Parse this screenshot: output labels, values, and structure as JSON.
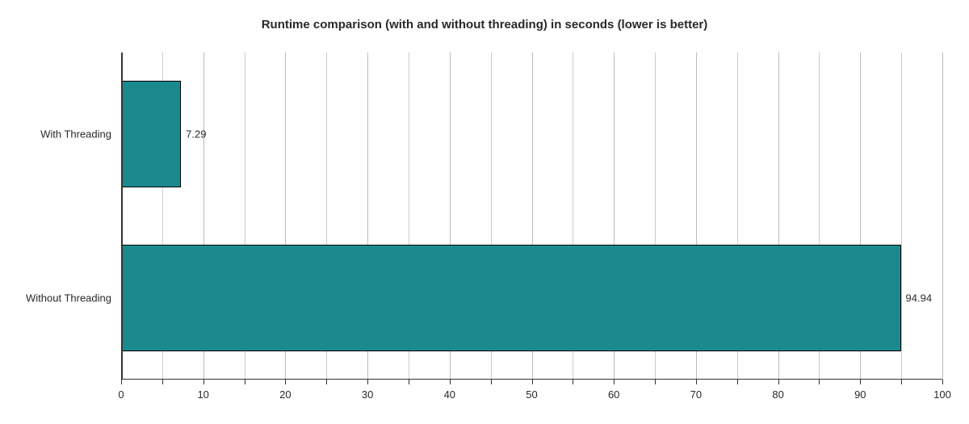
{
  "chart_data": {
    "type": "bar",
    "orientation": "horizontal",
    "title": "Runtime comparison (with and without threading) in seconds (lower is better)",
    "categories": [
      "With Threading",
      "Without Threading"
    ],
    "values": [
      7.29,
      94.94
    ],
    "xlim": [
      0,
      100
    ],
    "xticks": [
      0,
      5,
      10,
      15,
      20,
      25,
      30,
      35,
      40,
      45,
      50,
      55,
      60,
      65,
      70,
      75,
      80,
      85,
      90,
      95,
      100
    ],
    "xtick_labels": [
      "0",
      "",
      "10",
      "",
      "20",
      "",
      "30",
      "",
      "40",
      "",
      "50",
      "",
      "60",
      "",
      "70",
      "",
      "80",
      "",
      "90",
      "",
      "100"
    ],
    "bar_color": "#1b8a8f",
    "xlabel": "",
    "ylabel": ""
  }
}
